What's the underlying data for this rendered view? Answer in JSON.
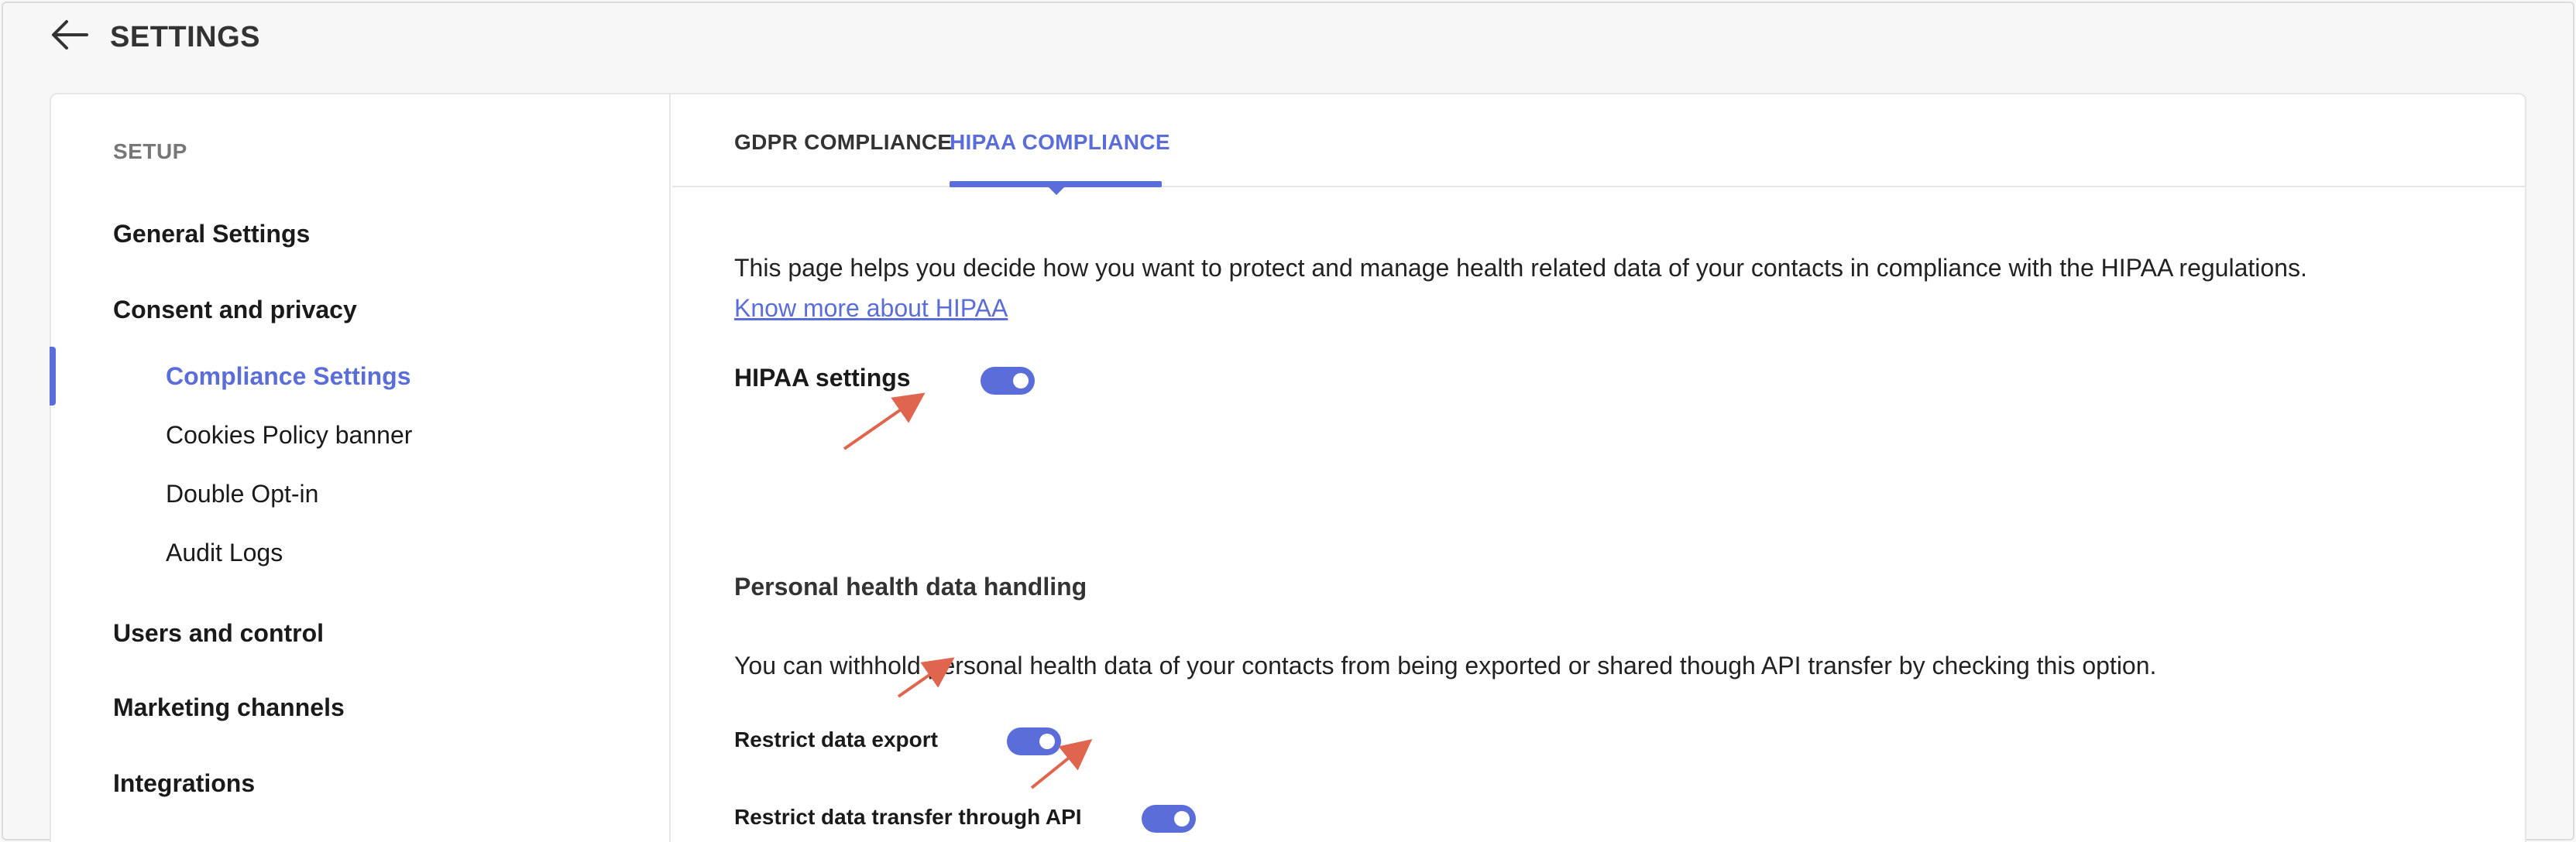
{
  "header": {
    "title": "SETTINGS",
    "back_icon": "arrow-left-icon"
  },
  "sidebar": {
    "heading": "SETUP",
    "items": [
      {
        "label": "General Settings",
        "level": "top"
      },
      {
        "label": "Consent and privacy",
        "level": "top"
      },
      {
        "label": "Compliance Settings",
        "level": "sub",
        "active": true
      },
      {
        "label": "Cookies Policy banner",
        "level": "sub"
      },
      {
        "label": "Double Opt-in",
        "level": "sub"
      },
      {
        "label": "Audit Logs",
        "level": "sub"
      },
      {
        "label": "Users and control",
        "level": "top"
      },
      {
        "label": "Marketing channels",
        "level": "top"
      },
      {
        "label": "Integrations",
        "level": "top"
      }
    ]
  },
  "tabs": [
    {
      "label": "GDPR COMPLIANCE",
      "active": false
    },
    {
      "label": "HIPAA COMPLIANCE",
      "active": true
    }
  ],
  "main": {
    "description": "This page helps you decide how you want to protect and manage health related data of your contacts in compliance with the HIPAA regulations.",
    "know_more_link": "Know more about HIPAA",
    "hipaa_settings_label": "HIPAA settings",
    "hipaa_settings_on": true,
    "section_title": "Personal health data handling",
    "section_description": "You can withhold personal health data of your contacts from being exported or shared though API transfer by checking this option.",
    "restrict_export_label": "Restrict data export",
    "restrict_export_on": true,
    "restrict_api_label": "Restrict data transfer through API",
    "restrict_api_on": true
  },
  "colors": {
    "accent": "#5b6dd8",
    "annotation_arrow": "#e0654f"
  }
}
